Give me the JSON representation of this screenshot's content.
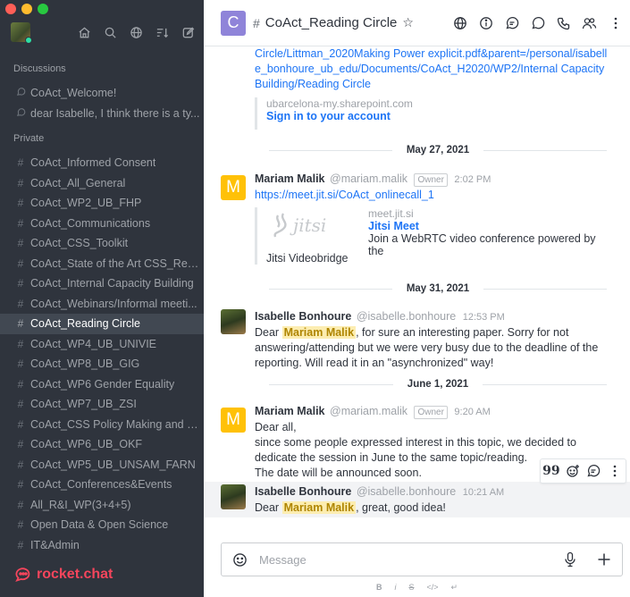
{
  "window": {
    "traffic_colors": [
      "#ff5f57",
      "#febc2e",
      "#28c840"
    ]
  },
  "sidebar": {
    "section_discussions": "Discussions",
    "section_private": "Private",
    "discussions": [
      {
        "label": "CoAct_Welcome!"
      },
      {
        "label": "dear Isabelle, I think there is a ty..."
      }
    ],
    "channels": [
      {
        "label": "CoAct_Informed Consent"
      },
      {
        "label": "CoAct_All_General"
      },
      {
        "label": "CoAct_WP2_UB_FHP"
      },
      {
        "label": "CoAct_Communications"
      },
      {
        "label": "CoAct_CSS_Toolkit"
      },
      {
        "label": "CoAct_State of the Art CSS_Rep..."
      },
      {
        "label": "CoAct_Internal Capacity Building"
      },
      {
        "label": "CoAct_Webinars/Informal meeti..."
      },
      {
        "label": "CoAct_Reading Circle",
        "active": true
      },
      {
        "label": "CoAct_WP4_UB_UNIVIE"
      },
      {
        "label": "CoAct_WP8_UB_GIG"
      },
      {
        "label": "CoAct_WP6 Gender Equality"
      },
      {
        "label": "CoAct_WP7_UB_ZSI"
      },
      {
        "label": "CoAct_CSS Policy Making and C..."
      },
      {
        "label": "CoAct_WP6_UB_OKF"
      },
      {
        "label": "CoAct_WP5_UB_UNSAM_FARN"
      },
      {
        "label": "CoAct_Conferences&Events"
      },
      {
        "label": "All_R&I_WP(3+4+5)"
      },
      {
        "label": "Open Data & Open Science"
      },
      {
        "label": "IT&Admin"
      }
    ],
    "logo_text": "rocket.chat"
  },
  "room": {
    "avatar_letter": "C",
    "avatar_color": "#8f84d9",
    "name": "CoAct_Reading Circle"
  },
  "messages": {
    "top_link": "Circle/Littman_2020Making Power explicit.pdf&parent=/personal/isabelle_bonhoure_ub_edu/Documents/CoAct_H2020/WP2/Internal Capacity Building/Reading Circle",
    "top_preview_site": "ubarcelona-my.sharepoint.com",
    "top_preview_title": "Sign in to your account",
    "date1": "May 27, 2021",
    "m1": {
      "avatar_letter": "M",
      "name": "Mariam Malik",
      "username": "@mariam.malik",
      "role": "Owner",
      "time": "2:02 PM",
      "link": "https://meet.jit.si/CoAct_onlinecall_1",
      "preview_site": "meet.jit.si",
      "preview_title": "Jitsi Meet",
      "preview_desc": "Join a WebRTC video conference powered by the",
      "preview_desc2": "Jitsi Videobridge",
      "preview_logo": "jitsi"
    },
    "date2": "May 31, 2021",
    "m2": {
      "name": "Isabelle Bonhoure",
      "username": "@isabelle.bonhoure",
      "time": "12:53 PM",
      "pre": "Dear",
      "mention": "Mariam Malik",
      "text": ", for sure an interesting paper. Sorry for not answering/attending but we were very busy due to the deadline of the reporting. Will read it in an \"asynchronized\" way!"
    },
    "date3": "June 1, 2021",
    "m3": {
      "avatar_letter": "M",
      "name": "Mariam Malik",
      "username": "@mariam.malik",
      "role": "Owner",
      "time": "9:20 AM",
      "line1": "Dear all,",
      "line2": "since some people expressed interest in this topic, we decided to dedicate the session in June to the same topic/reading.",
      "line3": "The date will be announced soon."
    },
    "m4": {
      "name": "Isabelle Bonhoure",
      "username": "@isabelle.bonhoure",
      "time": "10:21 AM",
      "pre": "Dear",
      "mention": "Mariam Malik",
      "text": ", great, good idea!"
    }
  },
  "composer": {
    "placeholder": "Message",
    "format_items": [
      "B",
      "i",
      "S",
      "</>",
      "↵"
    ]
  }
}
